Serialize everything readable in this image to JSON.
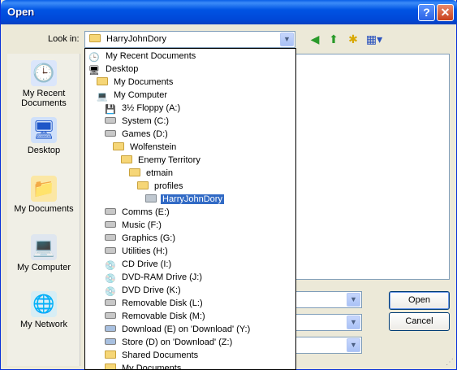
{
  "window": {
    "title": "Open",
    "help": "?",
    "close": "✕"
  },
  "toolbar": {
    "look_in_label": "Look in:",
    "look_in_value": "HarryJohnDory",
    "back_glyph": "◀",
    "up_glyph": "⬆",
    "newfolder_glyph": "✱",
    "views_glyph": "▦▾"
  },
  "places": [
    {
      "label": "My Recent Documents",
      "icon": "recent-documents-icon"
    },
    {
      "label": "Desktop",
      "icon": "desktop-icon"
    },
    {
      "label": "My Documents",
      "icon": "my-documents-icon"
    },
    {
      "label": "My Computer",
      "icon": "my-computer-icon"
    },
    {
      "label": "My Network",
      "icon": "my-network-icon"
    }
  ],
  "dropdown": [
    {
      "label": "My Recent Documents",
      "type": "recent"
    },
    {
      "label": "Desktop",
      "type": "desktop"
    },
    {
      "label": "My Documents",
      "type": "folder"
    },
    {
      "label": "My Computer",
      "type": "computer"
    },
    {
      "label": "3½ Floppy (A:)",
      "type": "floppy"
    },
    {
      "label": "System (C:)",
      "type": "drive"
    },
    {
      "label": "Games (D:)",
      "type": "drive"
    },
    {
      "label": "Wolfenstein",
      "type": "folder"
    },
    {
      "label": "Enemy Territory",
      "type": "folder"
    },
    {
      "label": "etmain",
      "type": "folder"
    },
    {
      "label": "profiles",
      "type": "folder"
    },
    {
      "label": "HarryJohnDory",
      "type": "folder-open",
      "selected": true
    },
    {
      "label": "Comms (E:)",
      "type": "drive"
    },
    {
      "label": "Music (F:)",
      "type": "drive"
    },
    {
      "label": "Graphics (G:)",
      "type": "drive"
    },
    {
      "label": "Utilities (H:)",
      "type": "drive"
    },
    {
      "label": "CD Drive (I:)",
      "type": "cd"
    },
    {
      "label": "DVD-RAM Drive (J:)",
      "type": "cd"
    },
    {
      "label": "DVD Drive (K:)",
      "type": "cd"
    },
    {
      "label": "Removable Disk (L:)",
      "type": "drive"
    },
    {
      "label": "Removable Disk (M:)",
      "type": "drive"
    },
    {
      "label": "Download (E) on 'Download' (Y:)",
      "type": "netdrive"
    },
    {
      "label": "Store (D) on 'Download' (Z:)",
      "type": "netdrive"
    },
    {
      "label": "Shared Documents",
      "type": "folder"
    },
    {
      "label": "My Documents",
      "type": "folder"
    }
  ],
  "buttons": {
    "open": "Open",
    "cancel": "Cancel"
  },
  "arrow_glyph": "▼"
}
